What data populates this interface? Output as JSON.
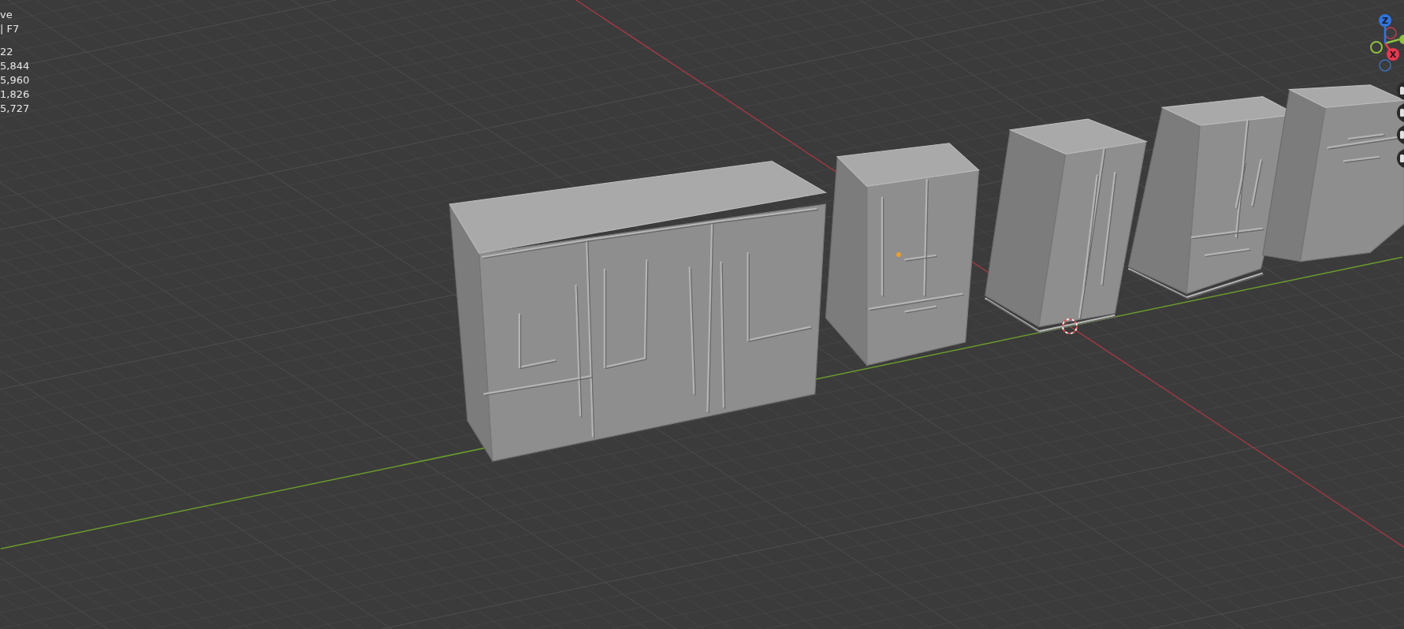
{
  "overlay": {
    "header_lines": [
      "ve",
      "| F7"
    ],
    "stat_lines": [
      "22",
      "5,844",
      "5,960",
      "1,826",
      "5,727"
    ]
  },
  "gizmo": {
    "axes": [
      {
        "kind": "z",
        "label": "Z"
      },
      {
        "kind": "x",
        "label": "X"
      }
    ]
  }
}
